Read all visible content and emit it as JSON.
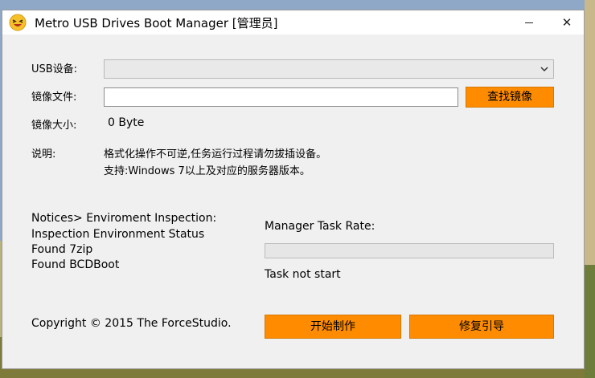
{
  "window": {
    "title": "Metro USB Drives Boot Manager [管理员]",
    "minimize_icon": "minimize-icon",
    "close_label": "✕"
  },
  "form": {
    "usb_label": "USB设备:",
    "usb_selected": "",
    "image_label": "镜像文件:",
    "image_value": "",
    "browse_label": "查找镜像",
    "size_label": "镜像大小:",
    "size_value": "0 Byte",
    "desc_label": "说明:",
    "desc_line1": "格式化操作不可逆,任务运行过程请勿拔插设备。",
    "desc_line2": "支持:Windows 7以上及对应的服务器版本。"
  },
  "notices": [
    "Notices> Enviroment Inspection:",
    "Inspection Environment Status",
    "Found 7zip",
    "Found BCDBoot"
  ],
  "task": {
    "rate_label": "Manager Task Rate:",
    "progress": 0,
    "status": "Task not start"
  },
  "footer": {
    "copyright": "Copyright © 2015 The ForceStudio.",
    "start_label": "开始制作",
    "repair_label": "修复引导"
  },
  "colors": {
    "accent": "#ff8c00",
    "window_bg": "#f0f0f0"
  }
}
